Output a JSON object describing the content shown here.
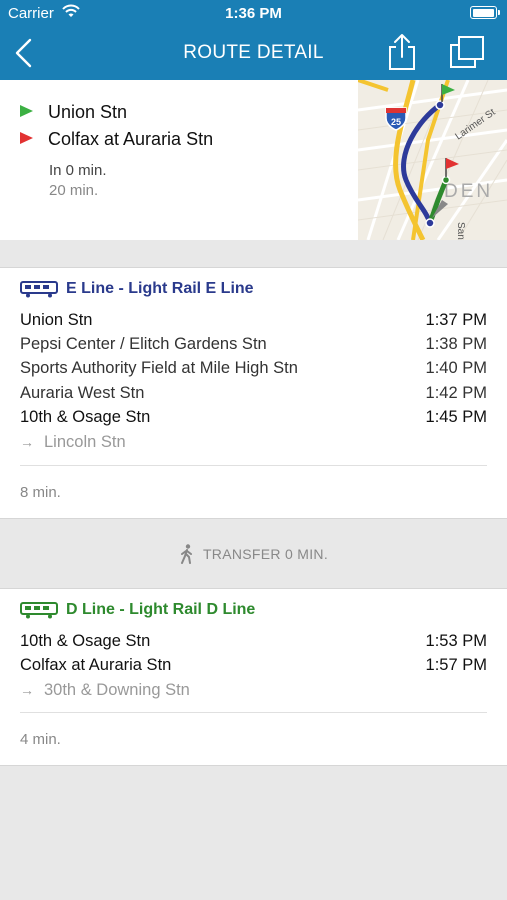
{
  "status_bar": {
    "carrier": "Carrier",
    "time": "1:36 PM"
  },
  "nav": {
    "title": "ROUTE DETAIL"
  },
  "summary": {
    "origin": "Union Stn",
    "destination": "Colfax at Auraria Stn",
    "departure": "In 0 min.",
    "duration": "20 min.",
    "map_labels": {
      "street": "Larimer St",
      "interstate": "25",
      "area": "DEN",
      "street2": "Santa"
    }
  },
  "legs": [
    {
      "line": "E Line - Light Rail E Line",
      "color": "#2a3a8c",
      "stops": [
        {
          "name": "Union Stn",
          "time": "1:37 PM"
        },
        {
          "name": "Pepsi Center / Elitch Gardens Stn",
          "time": "1:38 PM"
        },
        {
          "name": "Sports Authority Field at Mile High Stn",
          "time": "1:40 PM"
        },
        {
          "name": "Auraria West Stn",
          "time": "1:42 PM"
        },
        {
          "name": "10th & Osage Stn",
          "time": "1:45 PM"
        }
      ],
      "headsign": "Lincoln Stn",
      "duration": "8 min."
    },
    {
      "line": "D Line - Light Rail D Line",
      "color": "#2e8a2e",
      "stops": [
        {
          "name": "10th & Osage Stn",
          "time": "1:53 PM"
        },
        {
          "name": "Colfax at Auraria Stn",
          "time": "1:57 PM"
        }
      ],
      "headsign": "30th & Downing Stn",
      "duration": "4 min."
    }
  ],
  "transfer": {
    "label": "TRANSFER 0 MIN."
  }
}
